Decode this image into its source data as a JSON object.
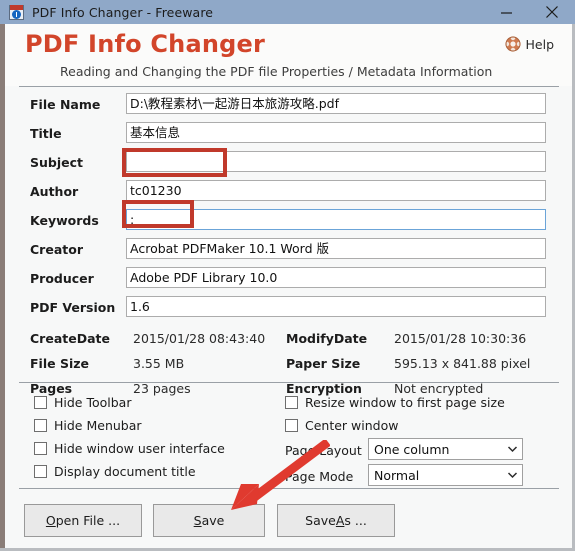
{
  "window": {
    "title": "PDF Info Changer - Freeware",
    "icon": "pdf-info-app-icon",
    "controls": {
      "minimize": "minimize-icon",
      "close": "close-icon"
    },
    "titlebar_color": "#8fa8c8"
  },
  "header": {
    "brand_title": "PDF Info Changer",
    "brand_subtitle": "Reading and Changing the PDF file Properties / Metadata Information",
    "help_label": "Help",
    "help_icon": "life-preserver-icon",
    "title_color": "#d2452a"
  },
  "form": {
    "fields": [
      {
        "label": "File Name",
        "value": "D:\\教程素材\\一起游日本旅游攻略.pdf",
        "focused": false
      },
      {
        "label": "Title",
        "value": "基本信息",
        "focused": false
      },
      {
        "label": "Subject",
        "value": "",
        "focused": false
      },
      {
        "label": "Author",
        "value": "tc01230",
        "focused": false
      },
      {
        "label": "Keywords",
        "value": ":",
        "focused": true
      },
      {
        "label": "Creator",
        "value": "Acrobat PDFMaker 10.1 Word 版",
        "focused": false
      },
      {
        "label": "Producer",
        "value": "Adobe PDF Library 10.0",
        "focused": false
      },
      {
        "label": "PDF Version",
        "value": "1.6",
        "focused": false
      }
    ]
  },
  "info": {
    "rows": [
      {
        "label1": "CreateDate",
        "value1": "2015/01/28 08:43:40",
        "label2": "ModifyDate",
        "value2": "2015/01/28 10:30:36"
      },
      {
        "label1": "File Size",
        "value1": "3.55 MB",
        "label2": "Paper Size",
        "value2": "595.13 x 841.88 pixel"
      },
      {
        "label1": "Pages",
        "value1": "23 pages",
        "label2": "Encryption",
        "value2": "Not encrypted"
      }
    ]
  },
  "options": {
    "checkboxes_left": [
      {
        "label": "Hide Toolbar",
        "checked": false
      },
      {
        "label": "Hide Menubar",
        "checked": false
      },
      {
        "label": "Hide window user interface",
        "checked": false
      },
      {
        "label": "Display document title",
        "checked": false
      }
    ],
    "checkboxes_right": [
      {
        "label": "Resize window to first page size",
        "checked": false
      },
      {
        "label": "Center window",
        "checked": false
      }
    ],
    "selects": [
      {
        "label": "Page Layout",
        "value": "One column"
      },
      {
        "label": "Page Mode",
        "value": "Normal"
      }
    ]
  },
  "buttons": [
    {
      "pre": "",
      "acc": "O",
      "post": "pen File ..."
    },
    {
      "pre": "",
      "acc": "S",
      "post": "ave"
    },
    {
      "pre": "Save ",
      "acc": "A",
      "post": "s ..."
    }
  ],
  "annotations": {
    "color": "#c0392b",
    "boxes": [
      {
        "name": "subject-field-highlight"
      },
      {
        "name": "keywords-field-highlight"
      }
    ],
    "arrow": {
      "name": "save-button-arrow"
    }
  }
}
